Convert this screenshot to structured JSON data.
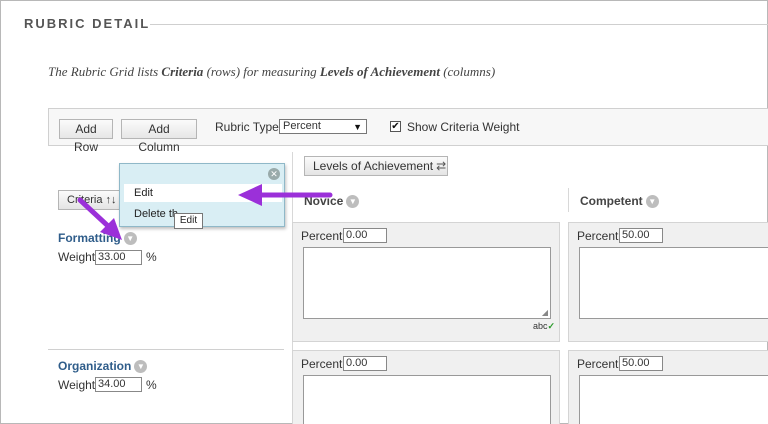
{
  "section": {
    "title": "RUBRIC DETAIL"
  },
  "intro": {
    "part1": "The Rubric Grid lists ",
    "criteria": "Criteria",
    "part2": " (rows) for measuring ",
    "levels": "Levels of Achievement",
    "part3": " (columns)"
  },
  "toolbar": {
    "add_row_label": "Add Row",
    "add_column_label": "Add Column",
    "rubric_type_label": "Rubric Type:",
    "rubric_type_value": "Percent",
    "show_weight_label": "Show Criteria Weight",
    "show_weight_checked": true
  },
  "grid": {
    "levels_button_label": "Levels of Achievement",
    "criteria_button_label": "Criteria",
    "columns": [
      {
        "name": "Novice"
      },
      {
        "name": "Competent"
      }
    ],
    "rows": [
      {
        "name": "Formatting",
        "weight_label": "Weight",
        "weight": "33.00",
        "unit": "%",
        "cells": [
          {
            "label": "Percent",
            "value": "0.00"
          },
          {
            "label": "Percent",
            "value": "50.00"
          }
        ]
      },
      {
        "name": "Organization",
        "weight_label": "Weight",
        "weight": "34.00",
        "unit": "%",
        "cells": [
          {
            "label": "Percent",
            "value": "0.00"
          },
          {
            "label": "Percent",
            "value": "50.00"
          }
        ]
      }
    ],
    "spellcheck_label": "abc"
  },
  "popup_menu": {
    "edit_label": "Edit",
    "delete_label": "Delete th",
    "tooltip": "Edit"
  },
  "colors": {
    "annotation_arrow": "#9b30d9",
    "popup_bg": "#d9eef4",
    "row_name": "#2f5d8a"
  },
  "icons": [
    "close-icon",
    "chevron-down-icon",
    "swap-icon",
    "sort-icon",
    "checkmark-icon",
    "resize-handle-icon",
    "spellcheck-icon"
  ]
}
